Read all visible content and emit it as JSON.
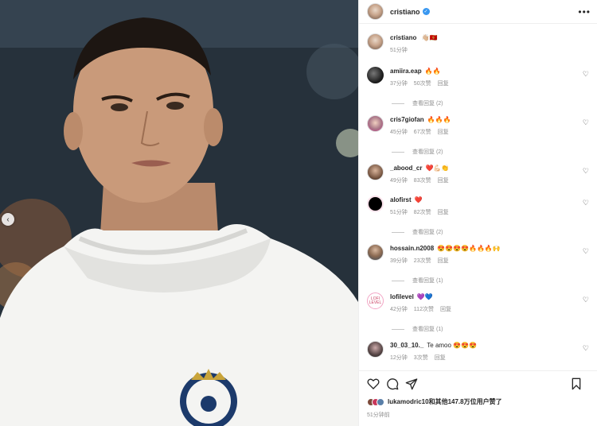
{
  "post": {
    "username": "cristiano",
    "caption_emojis": "👋🏼🇲🇪",
    "caption_time": "51分钟"
  },
  "comments": [
    {
      "user": "amiira.eap",
      "text": "🔥🔥",
      "time": "37分钟",
      "likes": "50次赞",
      "reply": "回复",
      "view_replies": "查看回复 (2)"
    },
    {
      "user": "cris7giofan",
      "text": "🔥🔥🔥",
      "time": "45分钟",
      "likes": "67次赞",
      "reply": "回复",
      "view_replies": "查看回复 (2)"
    },
    {
      "user": "_abood_cr",
      "text": "❤️💪🏻👏",
      "time": "49分钟",
      "likes": "83次赞",
      "reply": "回复",
      "view_replies": ""
    },
    {
      "user": "alofirst",
      "text": "❤️",
      "time": "51分钟",
      "likes": "82次赞",
      "reply": "回复",
      "view_replies": "查看回复 (2)"
    },
    {
      "user": "hossain.n2008",
      "text": "😍😍😍😍🔥🔥🔥🙌",
      "time": "39分钟",
      "likes": "23次赞",
      "reply": "回复",
      "view_replies": "查看回复 (1)"
    },
    {
      "user": "lofilevel",
      "text": "💜💙",
      "time": "42分钟",
      "likes": "112次赞",
      "reply": "回复",
      "view_replies": "查看回复 (1)"
    },
    {
      "user": "30_03_10._",
      "text": "Te amoo 😍😍😍",
      "time": "12分钟",
      "likes": "3次赞",
      "reply": "回复",
      "view_replies": ""
    }
  ],
  "actions": {
    "likes_text": "lukamodric10和其他147.8万位用户赞了",
    "posted_ago": "51分钟前"
  },
  "icons": [
    "more-icon",
    "heart-icon",
    "comment-icon",
    "share-icon",
    "bookmark-icon",
    "chevron-left-icon",
    "verified-icon"
  ],
  "colors": {
    "verified": "#3897f0",
    "meta_gray": "#8e8e8e"
  }
}
